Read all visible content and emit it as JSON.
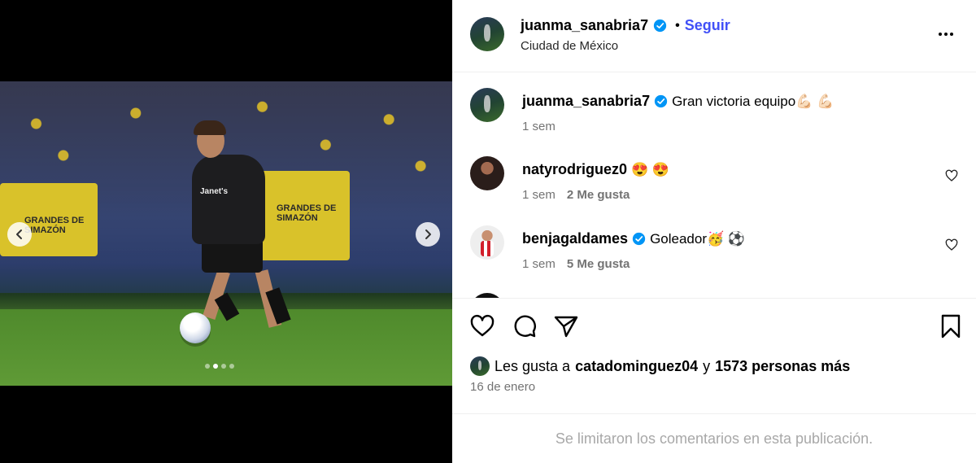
{
  "post": {
    "username": "juanma_sanabria7",
    "follow_label": "Seguir",
    "bullet": "•",
    "location": "Ciudad de México",
    "caption": "Gran victoria equipo💪🏻 💪🏻",
    "caption_time": "1 sem",
    "image_count": 4,
    "active_image_index": 1
  },
  "photo_text": {
    "sign_left": "GRANDES DE SIMAZÓN",
    "sign_right": "GRANDES DE SIMAZÓN",
    "jersey": "Janet's"
  },
  "comments": [
    {
      "username": "natyrodriguez0",
      "verified": false,
      "text": "😍 😍",
      "time": "1 sem",
      "likes": "2 Me gusta"
    },
    {
      "username": "benjagaldames",
      "verified": true,
      "text": "Goleador🥳 ⚽",
      "time": "1 sem",
      "likes": "5 Me gusta"
    }
  ],
  "likes": {
    "prefix": "Les gusta a",
    "user": "catadominguez04",
    "conj": "y",
    "others": "1573 personas más"
  },
  "date": "16 de enero",
  "comments_limited": "Se limitaron los comentarios en esta publicación.",
  "colors": {
    "follow": "#4150f7",
    "verified": "#0095f6",
    "muted": "#737373"
  },
  "icons": [
    "heart-icon",
    "comment-icon",
    "share-icon",
    "bookmark-icon",
    "more-icon",
    "chevron-left-icon",
    "chevron-right-icon",
    "verified-icon"
  ]
}
